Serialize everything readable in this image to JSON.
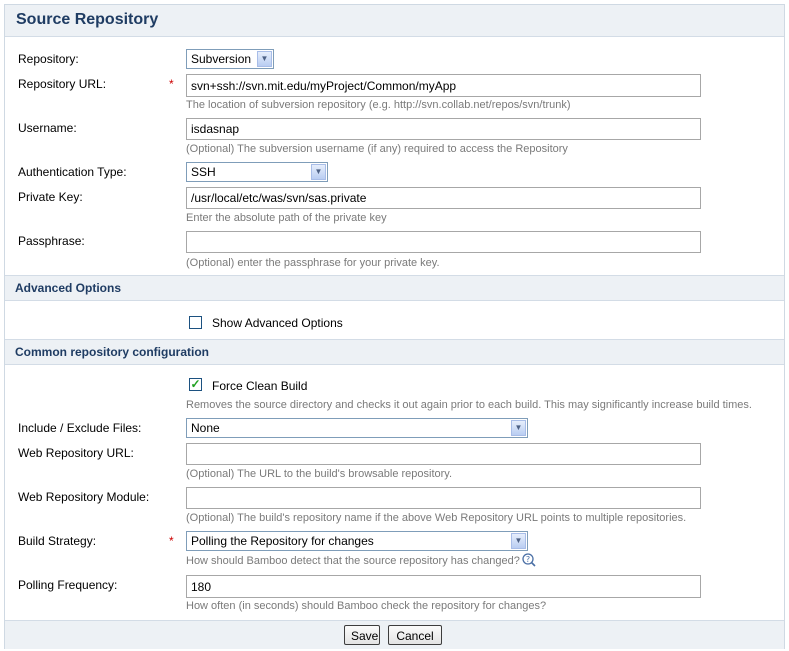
{
  "title": "Source Repository",
  "fields": {
    "repository": {
      "label": "Repository:",
      "value": "Subversion"
    },
    "repo_url": {
      "label": "Repository URL:",
      "required": "*",
      "value": "svn+ssh://svn.mit.edu/myProject/Common/myApp",
      "desc": "The location of subversion repository (e.g. http://svn.collab.net/repos/svn/trunk)"
    },
    "username": {
      "label": "Username:",
      "value": "isdasnap",
      "desc": "(Optional) The subversion username (if any) required to access the Repository"
    },
    "auth_type": {
      "label": "Authentication Type:",
      "value": "SSH"
    },
    "private_key": {
      "label": "Private Key:",
      "value": "/usr/local/etc/was/svn/sas.private",
      "desc": "Enter the absolute path of the private key"
    },
    "passphrase": {
      "label": "Passphrase:",
      "value": "",
      "desc": "(Optional) enter the passphrase for your private key."
    }
  },
  "advanced": {
    "header": "Advanced Options",
    "show_label": "Show Advanced Options",
    "show_checked": false
  },
  "common": {
    "header": "Common repository configuration",
    "force_clean": {
      "label": "Force Clean Build",
      "checked": true,
      "desc": "Removes the source directory and checks it out again prior to each build. This may significantly increase build times."
    },
    "include_exclude": {
      "label": "Include / Exclude Files:",
      "value": "None"
    },
    "web_repo_url": {
      "label": "Web Repository URL:",
      "value": "",
      "desc": "(Optional) The URL to the build's browsable repository."
    },
    "web_repo_module": {
      "label": "Web Repository Module:",
      "value": "",
      "desc": "(Optional) The build's repository name if the above Web Repository URL points to multiple repositories."
    },
    "build_strategy": {
      "label": "Build Strategy:",
      "required": "*",
      "value": "Polling the Repository for changes",
      "desc": "How should Bamboo detect that the source repository has changed?"
    },
    "polling_freq": {
      "label": "Polling Frequency:",
      "value": "180",
      "desc": "How often (in seconds) should Bamboo check the repository for changes?"
    }
  },
  "buttons": {
    "save": "Save",
    "cancel": "Cancel"
  },
  "icons": {
    "help": "help-icon",
    "dropdown": "chevron-down-icon",
    "check": "checkmark-icon"
  },
  "colors": {
    "header_text": "#1f3c63",
    "section_bg": "#edf1f5",
    "required": "#cc0000"
  }
}
